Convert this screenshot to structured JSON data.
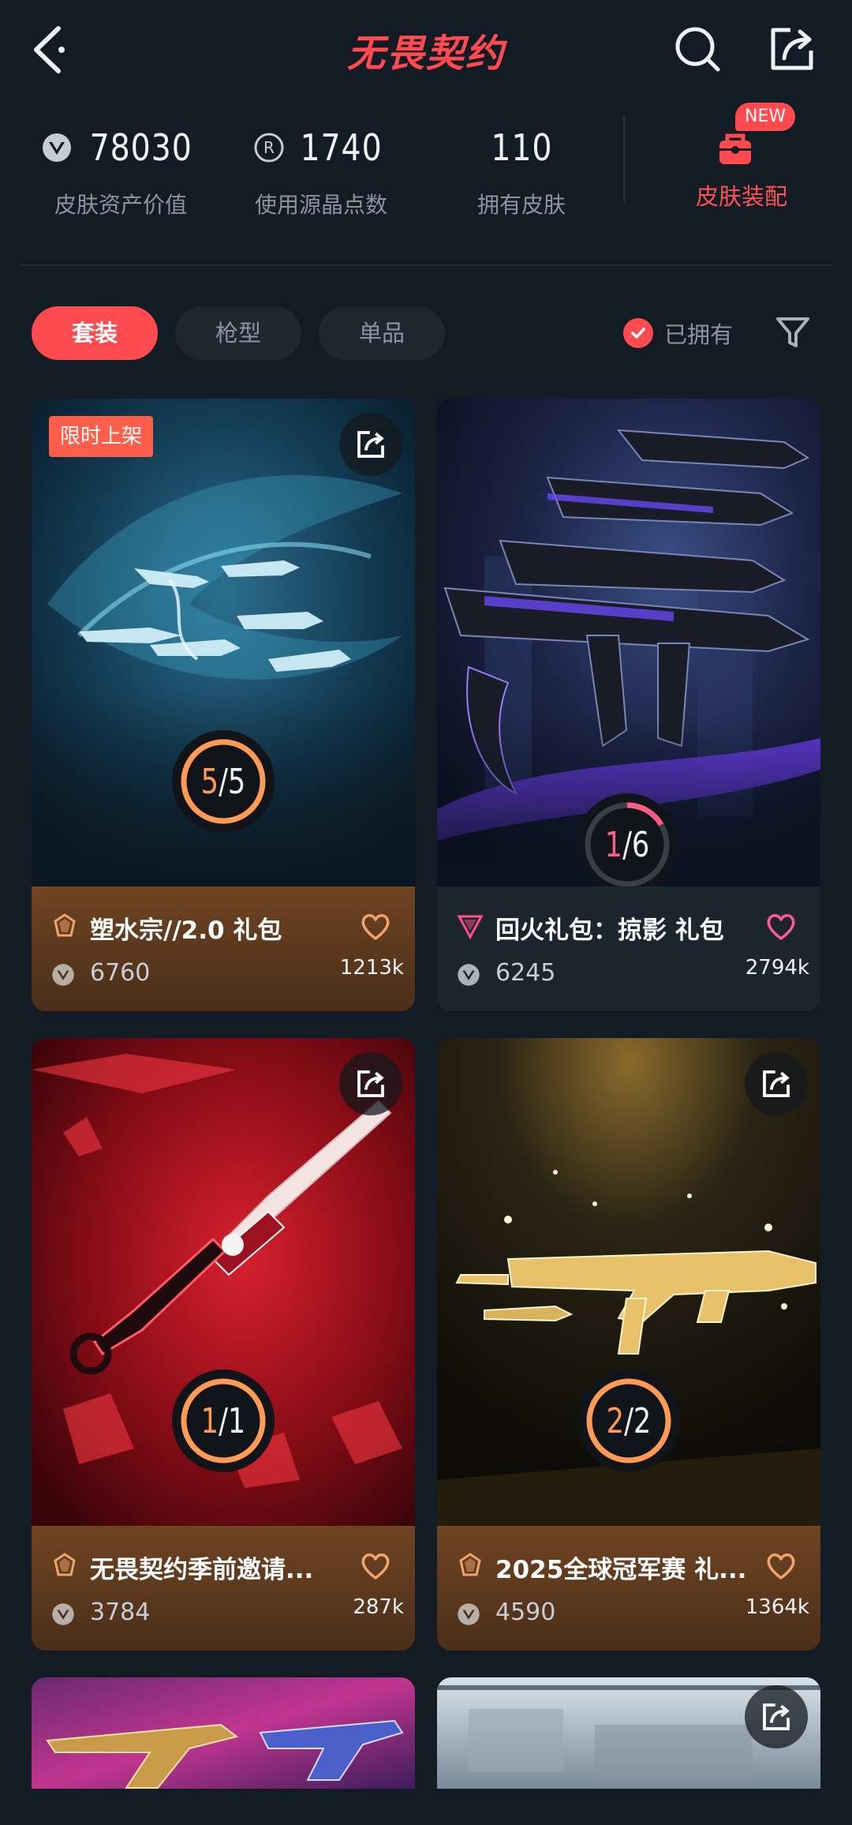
{
  "header": {
    "title": "无畏契约"
  },
  "stats": {
    "asset_value": {
      "value": "78030",
      "label": "皮肤资产价值"
    },
    "crystal_points": {
      "value": "1740",
      "label": "使用源晶点数"
    },
    "skins_owned": {
      "value": "110",
      "label": "拥有皮肤"
    },
    "loadout": {
      "label": "皮肤装配",
      "badge": "NEW"
    }
  },
  "filters": {
    "tabs": [
      {
        "label": "套装",
        "active": true
      },
      {
        "label": "枪型",
        "active": false
      },
      {
        "label": "单品",
        "active": false
      }
    ],
    "owned_toggle": {
      "label": "已拥有",
      "checked": true
    }
  },
  "cards": [
    {
      "name": "塑水宗//2.0 礼包",
      "badge": "限时上架",
      "owned": "5",
      "total": "5",
      "price": "6760",
      "favorites": "1213k",
      "tier_color": "#f2a36b",
      "footer_style": "gold",
      "art": "ocean"
    },
    {
      "name": "回火礼包：掠影 礼包",
      "badge": "",
      "owned": "1",
      "total": "6",
      "price": "6245",
      "favorites": "2794k",
      "tier_color": "#ff4f8b",
      "footer_style": "dark",
      "art": "violet"
    },
    {
      "name": "无畏契约季前邀请...",
      "badge": "",
      "owned": "1",
      "total": "1",
      "price": "3784",
      "favorites": "287k",
      "tier_color": "#f2a36b",
      "footer_style": "gold",
      "art": "crimson"
    },
    {
      "name": "2025全球冠军赛 礼...",
      "badge": "",
      "owned": "2",
      "total": "2",
      "price": "4590",
      "favorites": "1364k",
      "tier_color": "#f2a36b",
      "footer_style": "gold",
      "art": "gold"
    }
  ]
}
